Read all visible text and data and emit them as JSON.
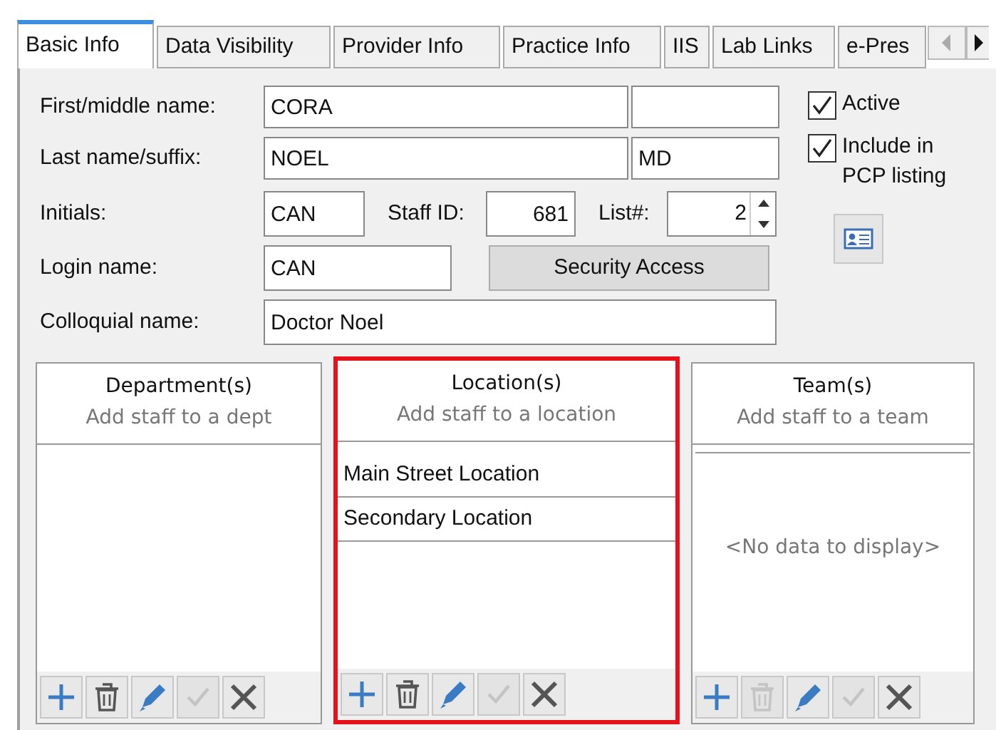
{
  "tabs": [
    {
      "label": "Basic Info",
      "selected": true
    },
    {
      "label": "Data Visibility",
      "selected": false
    },
    {
      "label": "Provider Info",
      "selected": false
    },
    {
      "label": "Practice Info",
      "selected": false
    },
    {
      "label": "IIS",
      "selected": false
    },
    {
      "label": "Lab Links",
      "selected": false
    },
    {
      "label": "e-Pres",
      "selected": false
    }
  ],
  "form": {
    "first_middle": {
      "label": "First/middle name:",
      "first": "CORA"
    },
    "last_suffix": {
      "label": "Last name/suffix:",
      "last": "NOEL",
      "suffix": "MD"
    },
    "initials": {
      "label": "Initials:",
      "value": "CAN"
    },
    "staff_id": {
      "label": "Staff ID:",
      "value": "681"
    },
    "list_number": {
      "label": "List#:",
      "value": "2"
    },
    "login": {
      "label": "Login name:",
      "value": "CAN"
    },
    "security_button": "Security Access",
    "colloquial": {
      "label": "Colloquial name:",
      "value": "Doctor Noel"
    }
  },
  "checkboxes": [
    {
      "label": "Active",
      "checked": true
    },
    {
      "label": "Include in PCP listing",
      "checked": true
    }
  ],
  "panels": [
    {
      "title": "Department(s)",
      "hint": "Add staff to a dept",
      "highlighted": false,
      "tools": [
        {
          "kind": "add",
          "disabled": false
        },
        {
          "kind": "delete",
          "disabled": false
        },
        {
          "kind": "edit",
          "disabled": false
        },
        {
          "kind": "accept",
          "disabled": true
        },
        {
          "kind": "cancel",
          "disabled": false
        }
      ]
    },
    {
      "title": "Location(s)",
      "hint": "Add staff to a location",
      "highlighted": true,
      "items": [
        "Main Street Location",
        "Secondary Location"
      ],
      "tools": [
        {
          "kind": "add",
          "disabled": false
        },
        {
          "kind": "delete",
          "disabled": false
        },
        {
          "kind": "edit",
          "disabled": false
        },
        {
          "kind": "accept",
          "disabled": true
        },
        {
          "kind": "cancel",
          "disabled": false
        }
      ]
    },
    {
      "title": "Team(s)",
      "hint": "Add staff to a team",
      "highlighted": false,
      "empty_text": "<No data to display>",
      "tools": [
        {
          "kind": "add",
          "disabled": false
        },
        {
          "kind": "delete",
          "disabled": true
        },
        {
          "kind": "edit",
          "disabled": false
        },
        {
          "kind": "accept",
          "disabled": true
        },
        {
          "kind": "cancel",
          "disabled": false
        }
      ]
    }
  ]
}
